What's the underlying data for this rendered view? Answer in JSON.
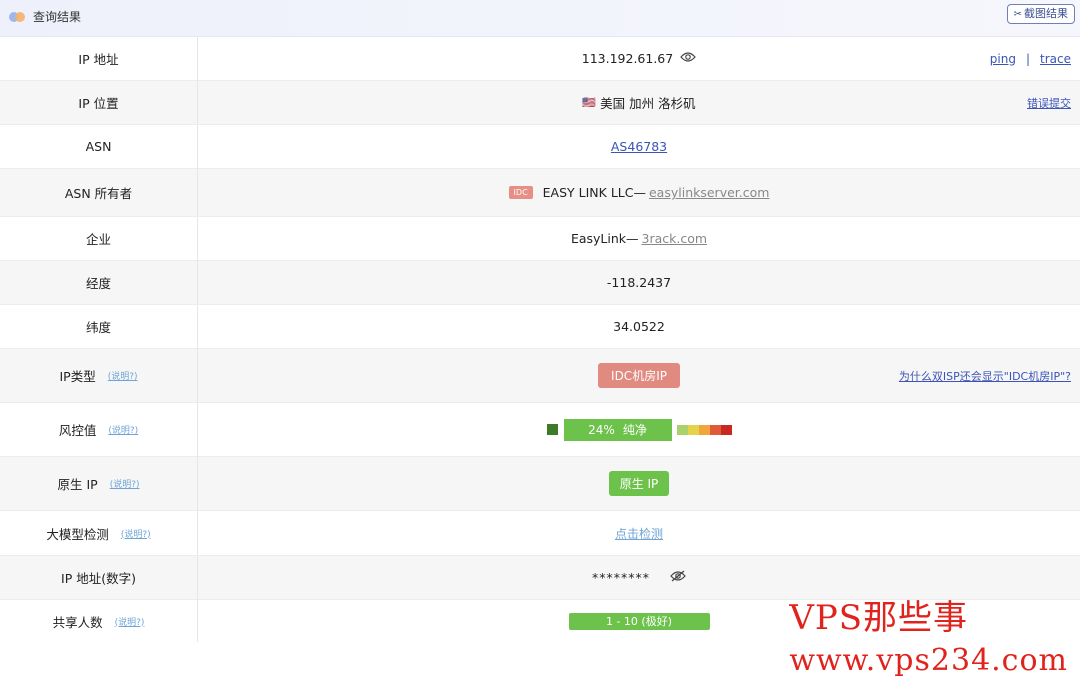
{
  "header": {
    "title": "查询结果",
    "screenshot_label": "截图结果"
  },
  "rows": {
    "ip": {
      "label": "IP 地址",
      "value": "113.192.61.67",
      "ping": "ping",
      "sep": "|",
      "trace": "trace"
    },
    "location": {
      "label": "IP 位置",
      "flag": "🇺🇸",
      "value": "美国 加州 洛杉矶",
      "action": "错误提交"
    },
    "asn": {
      "label": "ASN",
      "value": "AS46783"
    },
    "asn_owner": {
      "label": "ASN 所有者",
      "badge": "IDC",
      "name": "EASY LINK LLC—",
      "domain": "easylinkserver.com"
    },
    "company": {
      "label": "企业",
      "name": "EasyLink—",
      "domain": "3rack.com"
    },
    "longitude": {
      "label": "经度",
      "value": "-118.2437"
    },
    "latitude": {
      "label": "纬度",
      "value": "34.0522"
    },
    "ip_type": {
      "label": "IP类型",
      "help": "(说明?)",
      "value": "IDC机房IP",
      "question": "为什么双ISP还会显示\"IDC机房IP\"?"
    },
    "risk": {
      "label": "风控值",
      "help": "(说明?)",
      "percent": "24%",
      "text": "纯净",
      "level": 0.24
    },
    "native_ip": {
      "label": "原生 IP",
      "help": "(说明?)",
      "value": "原生 IP"
    },
    "llm_check": {
      "label": "大模型检测",
      "help": "(说明?)",
      "value": "点击检测"
    },
    "ip_numeric": {
      "label": "IP 地址(数字)",
      "value": "********"
    },
    "shared": {
      "label": "共享人数",
      "help": "(说明?)",
      "value": "1 - 10 (极好)"
    }
  },
  "colors": {
    "green": "#6dc24b",
    "dark_green": "#3d7a2a",
    "red_tag": "#e08a80",
    "link": "#3b54b8",
    "watermark": "#e0231d"
  },
  "risk_segments": [
    "#a9d36a",
    "#e6d34c",
    "#f0a63c",
    "#e05a3a",
    "#c8281e"
  ],
  "watermark": "VPS那些事\nwww.vps234.com"
}
